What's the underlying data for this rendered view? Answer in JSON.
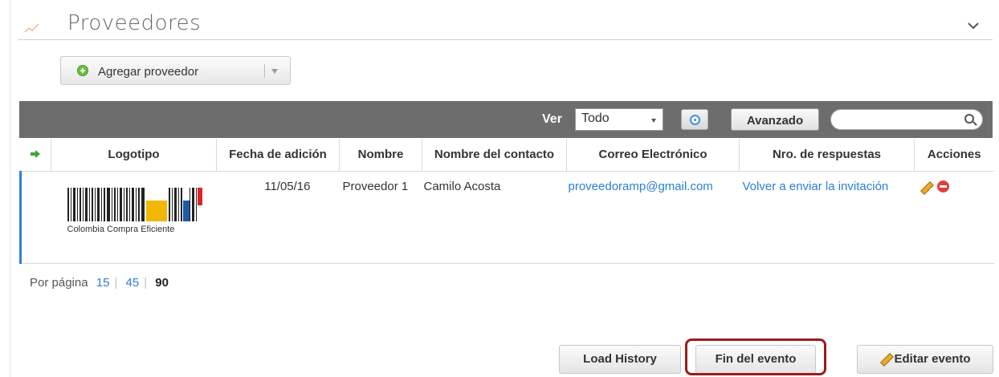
{
  "section": {
    "title": "Proveedores"
  },
  "add_button": {
    "label": "Agregar proveedor"
  },
  "toolbar": {
    "ver_label": "Ver",
    "ver_value": "Todo",
    "advanced_label": "Avanzado",
    "search_value": ""
  },
  "table": {
    "columns": [
      "",
      "Logotipo",
      "Fecha de adición",
      "Nombre",
      "Nombre del contacto",
      "Correo Electrónico",
      "Nro. de respuestas",
      "Acciones"
    ],
    "rows": [
      {
        "logo_text": "Colombia Compra Eficiente",
        "date": "11/05/16",
        "name": "Proveedor 1",
        "contact": "Camilo Acosta",
        "email": "proveedoramp@gmail.com",
        "responses": "Volver a enviar la invitación"
      }
    ]
  },
  "paging": {
    "label": "Por página",
    "options": [
      "15",
      "45",
      "90"
    ],
    "selected": "90"
  },
  "footer": {
    "load_history": "Load History",
    "fin_evento": "Fin del evento",
    "editar_evento": "Editar evento"
  },
  "colors": {
    "toolbar_bg": "#6d6d6d",
    "link": "#2a7fd4",
    "row_accent": "#2b82d9",
    "highlight_border": "#9c1c1c"
  }
}
